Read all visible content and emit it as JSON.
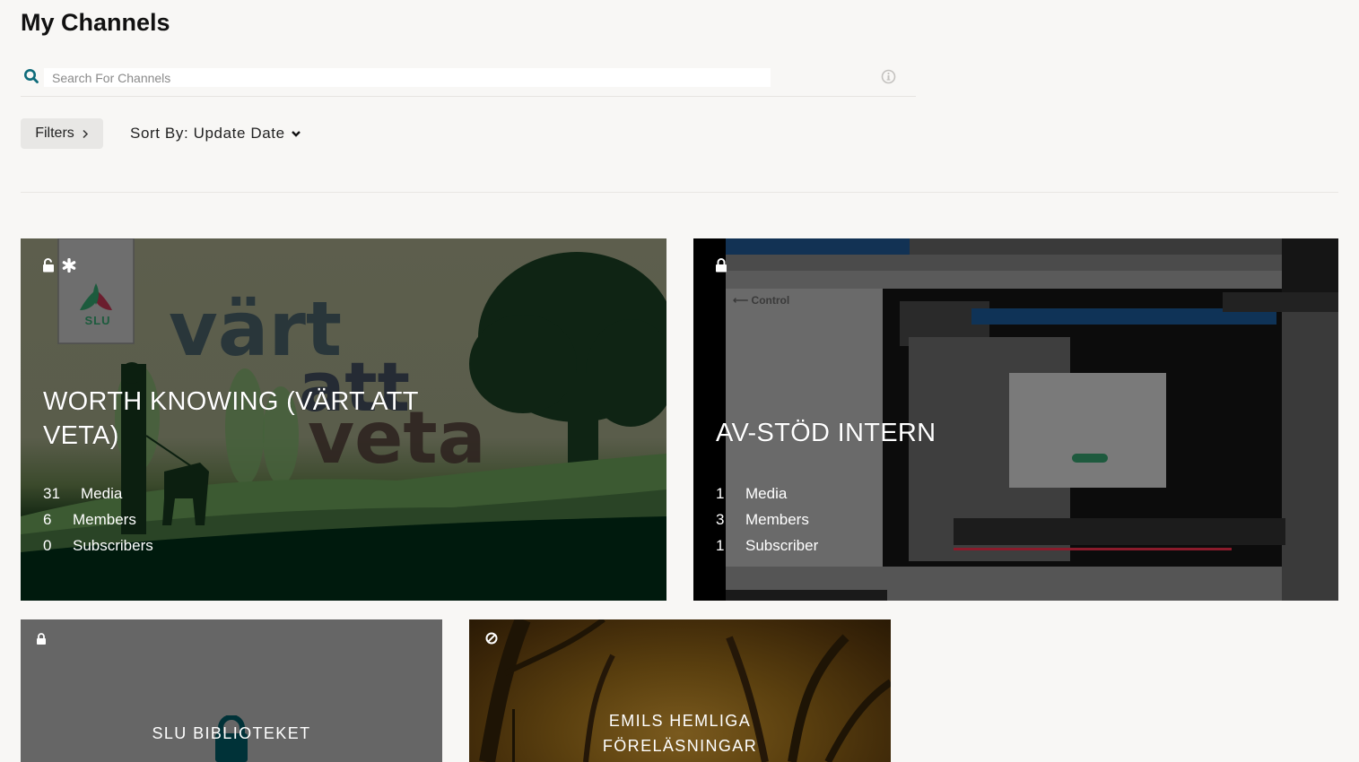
{
  "page": {
    "title": "My Channels"
  },
  "search": {
    "placeholder": "Search For Channels",
    "value": "",
    "icon": "search-icon",
    "info_icon": "info-icon"
  },
  "toolbar": {
    "filters_label": "Filters",
    "filters_icon": "chevron-right-icon",
    "sort_label": "Sort By: Update Date",
    "sort_icon": "chevron-down-icon"
  },
  "colors": {
    "accent": "#0e6b7a",
    "background": "#f8f7f5",
    "filters_bg": "#e8e7e5"
  },
  "channels": [
    {
      "title": "WORTH KNOWING (VÄRT ATT VETA)",
      "status_icons": [
        "unlock-icon",
        "asterisk-icon"
      ],
      "thumbnail": "Värt att veta landscape artwork with SLU logo",
      "logo_text": "SLU",
      "stats": [
        {
          "count": "31",
          "label": "Media"
        },
        {
          "count": "6",
          "label": "Members"
        },
        {
          "count": "0",
          "label": "Subscribers"
        }
      ]
    },
    {
      "title": "AV-STÖD INTERN",
      "status_icons": [
        "lock-icon"
      ],
      "thumbnail": "Screen recording of video meeting control panel",
      "stats": [
        {
          "count": "1",
          "label": "Media"
        },
        {
          "count": "3",
          "label": "Members"
        },
        {
          "count": "1",
          "label": "Subscriber"
        }
      ]
    },
    {
      "title": "SLU BIBLIOTEKET",
      "status_icons": [
        "lock-icon"
      ],
      "thumbnail": "Placeholder padlock"
    },
    {
      "title_line1": "EMILS HEMLIGA",
      "title_line2": "FÖRELÄSNINGAR",
      "status_icons": [
        "blocked-icon"
      ],
      "thumbnail": "Autumn tree-lined path"
    }
  ]
}
